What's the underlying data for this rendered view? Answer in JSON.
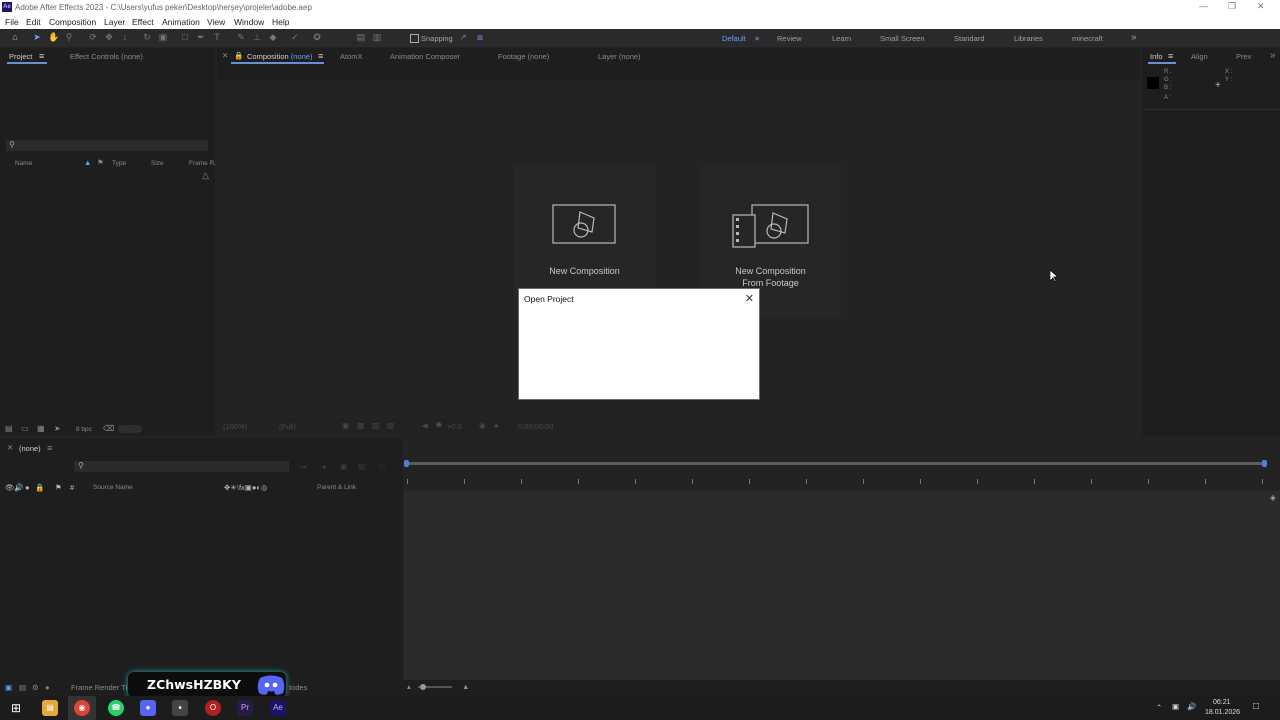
{
  "window": {
    "app_icon": "Ae",
    "title": "Adobe After Effects 2023 - C:\\Users\\yufus peker\\Desktop\\herşey\\projeler\\adobe.aep",
    "minimize_icon": "minimize-icon",
    "maximize_icon": "restore-icon",
    "close_icon": "close-icon"
  },
  "menu": [
    "File",
    "Edit",
    "Composition",
    "Layer",
    "Effect",
    "Animation",
    "View",
    "Window",
    "Help"
  ],
  "toolbar": {
    "snapping_label": "Snapping",
    "workspaces": [
      "Default",
      "Review",
      "Learn",
      "Small Screen",
      "Standard",
      "Libraries",
      "minecraft"
    ],
    "active_workspace": "Default"
  },
  "project_panel": {
    "tab_project": "Project",
    "tab_effect_controls": "Effect Controls",
    "tab_effect_controls_value": "(none)",
    "columns": [
      "Name",
      "Type",
      "Size",
      "Frame R."
    ],
    "bpc": "8 bpc"
  },
  "composition_panel": {
    "tab_composition": "Composition",
    "tab_composition_value": "(none)",
    "tab_atomx": "AtomX",
    "tab_animation_composer": "Animation Composer",
    "tab_footage": "Footage",
    "tab_footage_value": "(none)",
    "tab_layer": "Layer",
    "tab_layer_value": "(none)",
    "new_composition": "New Composition",
    "new_comp_from_footage_line1": "New Composition",
    "new_comp_from_footage_line2": "From Footage",
    "footer_zoom": "(100%)",
    "footer_res": "(Full)",
    "footer_exposure": "+0.0",
    "footer_time": "0;00;00;00"
  },
  "info_panel": {
    "tab_info": "Info",
    "tab_align": "Align",
    "tab_preview": "Prev",
    "r_label": "R :",
    "g_label": "G :",
    "b_label": "B :",
    "a_label": "A :",
    "x_label": "X :",
    "y_label": "Y :"
  },
  "dialog": {
    "title": "Open Project"
  },
  "timeline": {
    "tab_label": "(none)",
    "source_name": "Source Name",
    "parent_link": "Parent & Link",
    "frame_render_label": "Frame Render Ti",
    "modes_label": "todes"
  },
  "overlay": {
    "username": "ZChwsHZBKY"
  },
  "taskbar": {
    "time": "06:21",
    "date": "18.01.2026"
  }
}
